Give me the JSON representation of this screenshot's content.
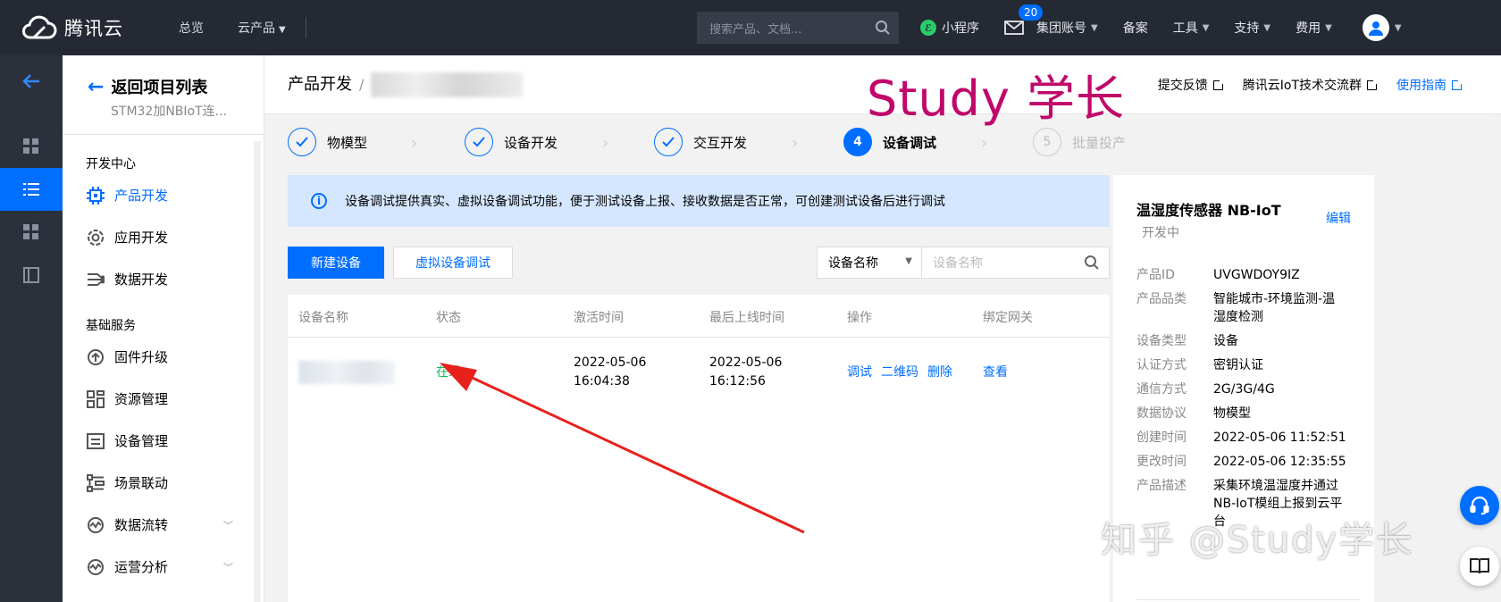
{
  "topbar": {
    "brand": "腾讯云",
    "nav": [
      {
        "label": "总览",
        "caret": false
      },
      {
        "label": "云产品",
        "caret": true
      }
    ],
    "search_placeholder": "搜索产品、文档...",
    "right": [
      {
        "label": "小程序"
      },
      {
        "label": "集团账号"
      },
      {
        "label": "备案"
      },
      {
        "label": "工具"
      },
      {
        "label": "支持"
      },
      {
        "label": "费用"
      }
    ],
    "mail_badge": "20"
  },
  "sidebar": {
    "back_label": "返回项目列表",
    "project_name": "STM32加NBIoT连...",
    "group1": "开发中心",
    "group1_items": [
      {
        "label": "产品开发",
        "active": true,
        "icon": "chip-icon"
      },
      {
        "label": "应用开发",
        "active": false,
        "icon": "app-ring-icon"
      },
      {
        "label": "数据开发",
        "active": false,
        "icon": "data-flow-icon"
      }
    ],
    "group2": "基础服务",
    "group2_items": [
      {
        "label": "固件升级",
        "icon": "firmware-icon",
        "chevron": false
      },
      {
        "label": "资源管理",
        "icon": "resource-icon",
        "chevron": false
      },
      {
        "label": "设备管理",
        "icon": "device-list-icon",
        "chevron": false
      },
      {
        "label": "场景联动",
        "icon": "scene-icon",
        "chevron": false
      },
      {
        "label": "数据流转",
        "icon": "data-transfer-icon",
        "chevron": true
      },
      {
        "label": "运营分析",
        "icon": "analytics-icon",
        "chevron": true
      }
    ]
  },
  "header": {
    "breadcrumb_root": "产品开发",
    "breadcrumb_sep": "/",
    "watermark": "Study 学长",
    "links": [
      {
        "label": "提交反馈",
        "blue": false
      },
      {
        "label": "腾讯云IoT技术交流群",
        "blue": false
      },
      {
        "label": "使用指南",
        "blue": true
      }
    ]
  },
  "steps": [
    {
      "label": "物模型",
      "state": "done",
      "num": ""
    },
    {
      "label": "设备开发",
      "state": "done",
      "num": ""
    },
    {
      "label": "交互开发",
      "state": "done",
      "num": ""
    },
    {
      "label": "设备调试",
      "state": "current",
      "num": "4"
    },
    {
      "label": "批量投产",
      "state": "todo",
      "num": "5"
    }
  ],
  "notice": "设备调试提供真实、虚拟设备调试功能，便于测试设备上报、接收数据是否正常，可创建测试设备后进行调试",
  "toolbar": {
    "new_device": "新建设备",
    "virtual_debug": "虚拟设备调试",
    "filter_select": "设备名称",
    "filter_placeholder": "设备名称"
  },
  "table": {
    "columns": [
      "设备名称",
      "状态",
      "激活时间",
      "最后上线时间",
      "操作",
      "绑定网关"
    ],
    "rows": [
      {
        "status": "在线",
        "activated_date": "2022-05-06",
        "activated_time": "16:04:38",
        "last_online_date": "2022-05-06",
        "last_online_time": "16:12:56",
        "ops": [
          "调试",
          "二维码",
          "删除"
        ],
        "gateway": "查看"
      }
    ]
  },
  "product": {
    "name": "温湿度传感器 NB-IoT",
    "edit": "编辑",
    "status": "开发中",
    "fields": [
      {
        "label": "产品ID",
        "value": "UVGWDOY9IZ"
      },
      {
        "label": "产品品类",
        "value": "智能城市-环境监测-温湿度检测"
      },
      {
        "label": "设备类型",
        "value": "设备"
      },
      {
        "label": "认证方式",
        "value": "密钥认证"
      },
      {
        "label": "通信方式",
        "value": "2G/3G/4G"
      },
      {
        "label": "数据协议",
        "value": "物模型"
      },
      {
        "label": "创建时间",
        "value": "2022-05-06 11:52:51"
      },
      {
        "label": "更改时间",
        "value": "2022-05-06 12:35:55"
      },
      {
        "label": "产品描述",
        "value": "采集环境温湿度并通过NB-IoT模组上报到云平台"
      }
    ]
  },
  "zhihu_watermark": "知乎 @Study学长",
  "colors": {
    "accent": "#006eff",
    "online": "#0abf5b",
    "topbar": "#242933",
    "watermark": "#c0086b",
    "annotation_arrow": "#e8211c"
  }
}
